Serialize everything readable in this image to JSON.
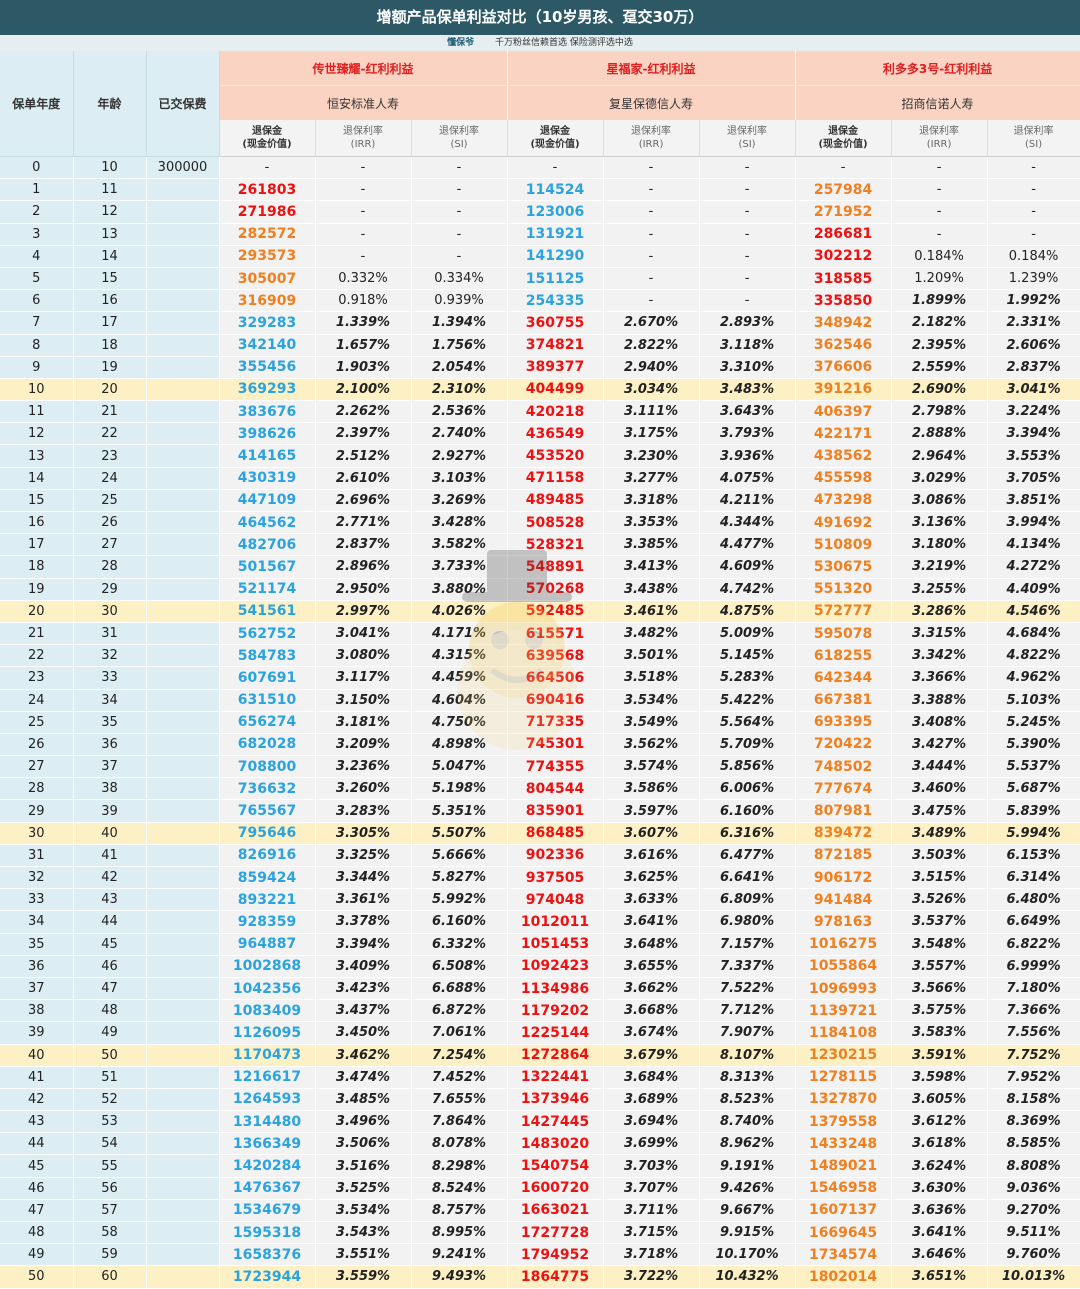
{
  "title": "增额产品保单利益对比（10岁男孩、趸交30万）",
  "subtitle": {
    "brand": "懂保爷",
    "tagline": "千万粉丝信赖首选  保险测评选中选"
  },
  "left_headers": {
    "year": "保单年度",
    "age": "年龄",
    "paid": "已交保费"
  },
  "products": [
    {
      "name": "传世臻耀-红利利益",
      "company": "恒安标准人寿"
    },
    {
      "name": "星福家-红利利益",
      "company": "复星保德信人寿"
    },
    {
      "name": "利多多3号-红利利益",
      "company": "招商信诺人寿"
    }
  ],
  "sub_headers": {
    "cv1": "退保金",
    "cv2": "(现金价值)",
    "irr1": "退保利率",
    "irr2": "(IRR)",
    "si1": "退保利率",
    "si2": "(SI)"
  },
  "colors": {
    "header_bg": "#2d5966",
    "blue": "#2aa3df",
    "red": "#ee1111",
    "orange": "#f07f1f",
    "highlight": "#fdf0c4"
  },
  "rows": [
    [
      "0",
      "10",
      "300000",
      "-",
      "-",
      "-",
      "-",
      "-",
      "-",
      "-",
      "-",
      "-"
    ],
    [
      "1",
      "11",
      "",
      "261803",
      "-",
      "-",
      "114524",
      "-",
      "-",
      "257984",
      "-",
      "-"
    ],
    [
      "2",
      "12",
      "",
      "271986",
      "-",
      "-",
      "123006",
      "-",
      "-",
      "271952",
      "-",
      "-"
    ],
    [
      "3",
      "13",
      "",
      "282572",
      "-",
      "-",
      "131921",
      "-",
      "-",
      "286681",
      "-",
      "-"
    ],
    [
      "4",
      "14",
      "",
      "293573",
      "-",
      "-",
      "141290",
      "-",
      "-",
      "302212",
      "0.184%",
      "0.184%"
    ],
    [
      "5",
      "15",
      "",
      "305007",
      "0.332%",
      "0.334%",
      "151125",
      "-",
      "-",
      "318585",
      "1.209%",
      "1.239%"
    ],
    [
      "6",
      "16",
      "",
      "316909",
      "0.918%",
      "0.939%",
      "254335",
      "-",
      "-",
      "335850",
      "1.899%",
      "1.992%"
    ],
    [
      "7",
      "17",
      "",
      "329283",
      "1.339%",
      "1.394%",
      "360755",
      "2.670%",
      "2.893%",
      "348942",
      "2.182%",
      "2.331%"
    ],
    [
      "8",
      "18",
      "",
      "342140",
      "1.657%",
      "1.756%",
      "374821",
      "2.822%",
      "3.118%",
      "362546",
      "2.395%",
      "2.606%"
    ],
    [
      "9",
      "19",
      "",
      "355456",
      "1.903%",
      "2.054%",
      "389377",
      "2.940%",
      "3.310%",
      "376606",
      "2.559%",
      "2.837%"
    ],
    [
      "10",
      "20",
      "",
      "369293",
      "2.100%",
      "2.310%",
      "404499",
      "3.034%",
      "3.483%",
      "391216",
      "2.690%",
      "3.041%"
    ],
    [
      "11",
      "21",
      "",
      "383676",
      "2.262%",
      "2.536%",
      "420218",
      "3.111%",
      "3.643%",
      "406397",
      "2.798%",
      "3.224%"
    ],
    [
      "12",
      "22",
      "",
      "398626",
      "2.397%",
      "2.740%",
      "436549",
      "3.175%",
      "3.793%",
      "422171",
      "2.888%",
      "3.394%"
    ],
    [
      "13",
      "23",
      "",
      "414165",
      "2.512%",
      "2.927%",
      "453520",
      "3.230%",
      "3.936%",
      "438562",
      "2.964%",
      "3.553%"
    ],
    [
      "14",
      "24",
      "",
      "430319",
      "2.610%",
      "3.103%",
      "471158",
      "3.277%",
      "4.075%",
      "455598",
      "3.029%",
      "3.705%"
    ],
    [
      "15",
      "25",
      "",
      "447109",
      "2.696%",
      "3.269%",
      "489485",
      "3.318%",
      "4.211%",
      "473298",
      "3.086%",
      "3.851%"
    ],
    [
      "16",
      "26",
      "",
      "464562",
      "2.771%",
      "3.428%",
      "508528",
      "3.353%",
      "4.344%",
      "491692",
      "3.136%",
      "3.994%"
    ],
    [
      "17",
      "27",
      "",
      "482706",
      "2.837%",
      "3.582%",
      "528321",
      "3.385%",
      "4.477%",
      "510809",
      "3.180%",
      "4.134%"
    ],
    [
      "18",
      "28",
      "",
      "501567",
      "2.896%",
      "3.733%",
      "548891",
      "3.413%",
      "4.609%",
      "530675",
      "3.219%",
      "4.272%"
    ],
    [
      "19",
      "29",
      "",
      "521174",
      "2.950%",
      "3.880%",
      "570268",
      "3.438%",
      "4.742%",
      "551320",
      "3.255%",
      "4.409%"
    ],
    [
      "20",
      "30",
      "",
      "541561",
      "2.997%",
      "4.026%",
      "592485",
      "3.461%",
      "4.875%",
      "572777",
      "3.286%",
      "4.546%"
    ],
    [
      "21",
      "31",
      "",
      "562752",
      "3.041%",
      "4.171%",
      "615571",
      "3.482%",
      "5.009%",
      "595078",
      "3.315%",
      "4.684%"
    ],
    [
      "22",
      "32",
      "",
      "584783",
      "3.080%",
      "4.315%",
      "639568",
      "3.501%",
      "5.145%",
      "618255",
      "3.342%",
      "4.822%"
    ],
    [
      "23",
      "33",
      "",
      "607691",
      "3.117%",
      "4.459%",
      "664506",
      "3.518%",
      "5.283%",
      "642344",
      "3.366%",
      "4.962%"
    ],
    [
      "24",
      "34",
      "",
      "631510",
      "3.150%",
      "4.604%",
      "690416",
      "3.534%",
      "5.422%",
      "667381",
      "3.388%",
      "5.103%"
    ],
    [
      "25",
      "35",
      "",
      "656274",
      "3.181%",
      "4.750%",
      "717335",
      "3.549%",
      "5.564%",
      "693395",
      "3.408%",
      "5.245%"
    ],
    [
      "26",
      "36",
      "",
      "682028",
      "3.209%",
      "4.898%",
      "745301",
      "3.562%",
      "5.709%",
      "720422",
      "3.427%",
      "5.390%"
    ],
    [
      "27",
      "37",
      "",
      "708800",
      "3.236%",
      "5.047%",
      "774355",
      "3.574%",
      "5.856%",
      "748502",
      "3.444%",
      "5.537%"
    ],
    [
      "28",
      "38",
      "",
      "736632",
      "3.260%",
      "5.198%",
      "804544",
      "3.586%",
      "6.006%",
      "777674",
      "3.460%",
      "5.687%"
    ],
    [
      "29",
      "39",
      "",
      "765567",
      "3.283%",
      "5.351%",
      "835901",
      "3.597%",
      "6.160%",
      "807981",
      "3.475%",
      "5.839%"
    ],
    [
      "30",
      "40",
      "",
      "795646",
      "3.305%",
      "5.507%",
      "868485",
      "3.607%",
      "6.316%",
      "839472",
      "3.489%",
      "5.994%"
    ],
    [
      "31",
      "41",
      "",
      "826916",
      "3.325%",
      "5.666%",
      "902336",
      "3.616%",
      "6.477%",
      "872185",
      "3.503%",
      "6.153%"
    ],
    [
      "32",
      "42",
      "",
      "859424",
      "3.344%",
      "5.827%",
      "937505",
      "3.625%",
      "6.641%",
      "906172",
      "3.515%",
      "6.314%"
    ],
    [
      "33",
      "43",
      "",
      "893221",
      "3.361%",
      "5.992%",
      "974048",
      "3.633%",
      "6.809%",
      "941484",
      "3.526%",
      "6.480%"
    ],
    [
      "34",
      "44",
      "",
      "928359",
      "3.378%",
      "6.160%",
      "1012011",
      "3.641%",
      "6.980%",
      "978163",
      "3.537%",
      "6.649%"
    ],
    [
      "35",
      "45",
      "",
      "964887",
      "3.394%",
      "6.332%",
      "1051453",
      "3.648%",
      "7.157%",
      "1016275",
      "3.548%",
      "6.822%"
    ],
    [
      "36",
      "46",
      "",
      "1002868",
      "3.409%",
      "6.508%",
      "1092423",
      "3.655%",
      "7.337%",
      "1055864",
      "3.557%",
      "6.999%"
    ],
    [
      "37",
      "47",
      "",
      "1042356",
      "3.423%",
      "6.688%",
      "1134986",
      "3.662%",
      "7.522%",
      "1096993",
      "3.566%",
      "7.180%"
    ],
    [
      "38",
      "48",
      "",
      "1083409",
      "3.437%",
      "6.872%",
      "1179202",
      "3.668%",
      "7.712%",
      "1139721",
      "3.575%",
      "7.366%"
    ],
    [
      "39",
      "49",
      "",
      "1126095",
      "3.450%",
      "7.061%",
      "1225144",
      "3.674%",
      "7.907%",
      "1184108",
      "3.583%",
      "7.556%"
    ],
    [
      "40",
      "50",
      "",
      "1170473",
      "3.462%",
      "7.254%",
      "1272864",
      "3.679%",
      "8.107%",
      "1230215",
      "3.591%",
      "7.752%"
    ],
    [
      "41",
      "51",
      "",
      "1216617",
      "3.474%",
      "7.452%",
      "1322441",
      "3.684%",
      "8.313%",
      "1278115",
      "3.598%",
      "7.952%"
    ],
    [
      "42",
      "52",
      "",
      "1264593",
      "3.485%",
      "7.655%",
      "1373946",
      "3.689%",
      "8.523%",
      "1327870",
      "3.605%",
      "8.158%"
    ],
    [
      "43",
      "53",
      "",
      "1314480",
      "3.496%",
      "7.864%",
      "1427445",
      "3.694%",
      "8.740%",
      "1379558",
      "3.612%",
      "8.369%"
    ],
    [
      "44",
      "54",
      "",
      "1366349",
      "3.506%",
      "8.078%",
      "1483020",
      "3.699%",
      "8.962%",
      "1433248",
      "3.618%",
      "8.585%"
    ],
    [
      "45",
      "55",
      "",
      "1420284",
      "3.516%",
      "8.298%",
      "1540754",
      "3.703%",
      "9.191%",
      "1489021",
      "3.624%",
      "8.808%"
    ],
    [
      "46",
      "56",
      "",
      "1476367",
      "3.525%",
      "8.524%",
      "1600720",
      "3.707%",
      "9.426%",
      "1546958",
      "3.630%",
      "9.036%"
    ],
    [
      "47",
      "57",
      "",
      "1534679",
      "3.534%",
      "8.757%",
      "1663021",
      "3.711%",
      "9.667%",
      "1607137",
      "3.636%",
      "9.270%"
    ],
    [
      "48",
      "58",
      "",
      "1595318",
      "3.543%",
      "8.995%",
      "1727728",
      "3.715%",
      "9.915%",
      "1669645",
      "3.641%",
      "9.511%"
    ],
    [
      "49",
      "59",
      "",
      "1658376",
      "3.551%",
      "9.241%",
      "1794952",
      "3.718%",
      "10.170%",
      "1734574",
      "3.646%",
      "9.760%"
    ],
    [
      "50",
      "60",
      "",
      "1723944",
      "3.559%",
      "9.493%",
      "1864775",
      "3.722%",
      "10.432%",
      "1802014",
      "3.651%",
      "10.013%"
    ]
  ],
  "highlight_years": [
    "10",
    "20",
    "30",
    "40",
    "50"
  ],
  "value_colors": [
    [
      "red",
      "red",
      "orange",
      "orange",
      "orange",
      "orange",
      "blue"
    ],
    [
      "blue",
      "blue",
      "blue",
      "blue",
      "blue",
      "blue",
      "red"
    ],
    [
      "orange",
      "orange",
      "red",
      "red",
      "red",
      "red",
      "orange"
    ]
  ],
  "watermark": "什么值得买"
}
